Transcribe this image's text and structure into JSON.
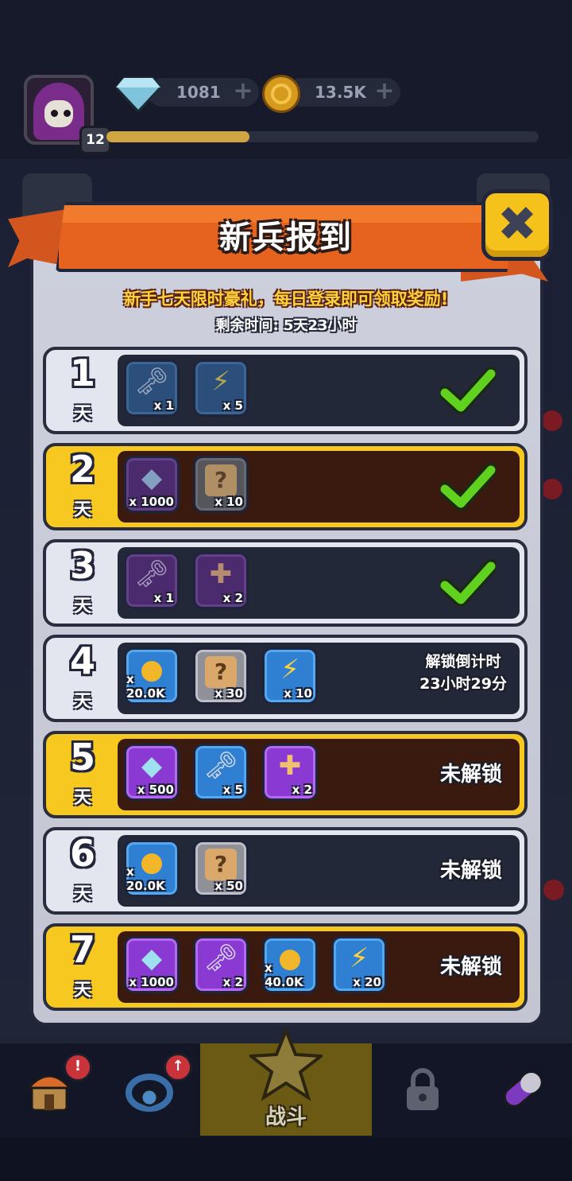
{
  "header": {
    "player_level": "12",
    "xp_fraction": 0.33,
    "gems": "1081",
    "gold": "13.5K"
  },
  "dialog": {
    "title": "新兵报到",
    "subtitle": "新手七天限时豪礼，每日登录即可领取奖励!",
    "timer_text": "剩余时间: 5天23小时"
  },
  "days": [
    {
      "day": "1",
      "day_word": "天",
      "style": "silver",
      "state": "claimed",
      "items": [
        {
          "icon": "key-icon",
          "color": "blue",
          "qty": "x 1"
        },
        {
          "icon": "lightning-icon",
          "color": "blue",
          "qty": "x 5"
        }
      ]
    },
    {
      "day": "2",
      "day_word": "天",
      "style": "gold",
      "state": "claimed",
      "items": [
        {
          "icon": "diamond-icon",
          "color": "purple",
          "qty": "x 1000"
        },
        {
          "icon": "mystery-box-icon",
          "color": "grey",
          "qty": "x 10"
        }
      ]
    },
    {
      "day": "3",
      "day_word": "天",
      "style": "silver",
      "state": "claimed",
      "items": [
        {
          "icon": "key-icon",
          "color": "purple",
          "qty": "x 1"
        },
        {
          "icon": "cross-scroll-icon",
          "color": "purple",
          "qty": "x 2"
        }
      ]
    },
    {
      "day": "4",
      "day_word": "天",
      "style": "silver",
      "state": "countdown",
      "status_line1": "解锁倒计时",
      "status_line2": "23小时29分",
      "items": [
        {
          "icon": "gold-coin-icon",
          "color": "blue",
          "qty": "x 20.0K"
        },
        {
          "icon": "mystery-box-icon",
          "color": "grey",
          "qty": "x 30"
        },
        {
          "icon": "lightning-icon",
          "color": "blue",
          "qty": "x 10"
        }
      ]
    },
    {
      "day": "5",
      "day_word": "天",
      "style": "gold",
      "state": "locked",
      "status": "未解锁",
      "items": [
        {
          "icon": "diamond-icon",
          "color": "purple",
          "qty": "x 500"
        },
        {
          "icon": "key-icon",
          "color": "blue",
          "qty": "x 5"
        },
        {
          "icon": "cross-scroll-icon",
          "color": "purple",
          "qty": "x 2"
        }
      ]
    },
    {
      "day": "6",
      "day_word": "天",
      "style": "silver",
      "state": "locked",
      "status": "未解锁",
      "items": [
        {
          "icon": "gold-coin-icon",
          "color": "blue",
          "qty": "x 20.0K"
        },
        {
          "icon": "mystery-box-icon",
          "color": "grey",
          "qty": "x 50"
        }
      ]
    },
    {
      "day": "7",
      "day_word": "天",
      "style": "gold",
      "state": "locked",
      "status": "未解锁",
      "items": [
        {
          "icon": "diamond-icon",
          "color": "purple",
          "qty": "x 1000"
        },
        {
          "icon": "key-icon",
          "color": "purple",
          "qty": "x 2"
        },
        {
          "icon": "gold-coin-icon",
          "color": "blue",
          "qty": "x 40.0K"
        },
        {
          "icon": "lightning-icon",
          "color": "blue",
          "qty": "x 20"
        }
      ]
    }
  ],
  "bottom_nav": {
    "battle_label": "战斗",
    "alert_mark": "!",
    "upgrade_mark": "↑"
  },
  "colors": {
    "ribbon": "#e5621f",
    "gold_row": "#f6c820",
    "silver_row": "#e3e5ef",
    "check_green": "#5fd11e"
  }
}
